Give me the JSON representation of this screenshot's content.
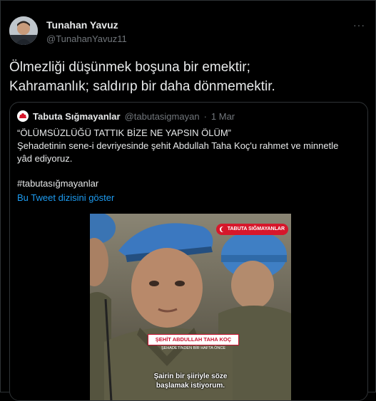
{
  "tweet": {
    "author_name": "Tunahan Yavuz",
    "author_handle": "@TunahanYavuz11",
    "more_icon": "more-horizontal-icon",
    "text_line1": "Ölmezliği düşünmek boşuna bir emektir;",
    "text_line2": "Kahramanlık; saldırıp bir daha dönmemektir."
  },
  "quote": {
    "author_name": "Tabuta Sığmayanlar",
    "author_handle": "@tabutasigmayan",
    "separator": "·",
    "date": "1 Mar",
    "line1": "“ÖLÜMSÜZLÜĞÜ TATTIK BİZE NE YAPSIN ÖLÜM”",
    "line2": "Şehadetinin sene-i devriyesinde şehit Abdullah Taha Koç'u rahmet ve minnetle",
    "line3": "yâd ediyoruz.",
    "hashtag": "#tabutasığmayanlar",
    "thread_link": "Bu Tweet dizisini göster"
  },
  "video": {
    "badge_label": "TABUTA SIĞMAYANLAR",
    "name_strip": "ŞEHİT ABDULLAH TAHA KOÇ",
    "name_sub": "ŞEHADETİNDEN BİR HAFTA ÖNCE",
    "subtitle_line1": "Şairin bir şiiriyle söze",
    "subtitle_line2": "başlamak istiyorum."
  },
  "colors": {
    "background": "#000000",
    "text": "#e7e9ea",
    "muted": "#71767b",
    "link": "#1d9bf0",
    "border": "#2f3336",
    "accent_red": "#d6172b"
  }
}
